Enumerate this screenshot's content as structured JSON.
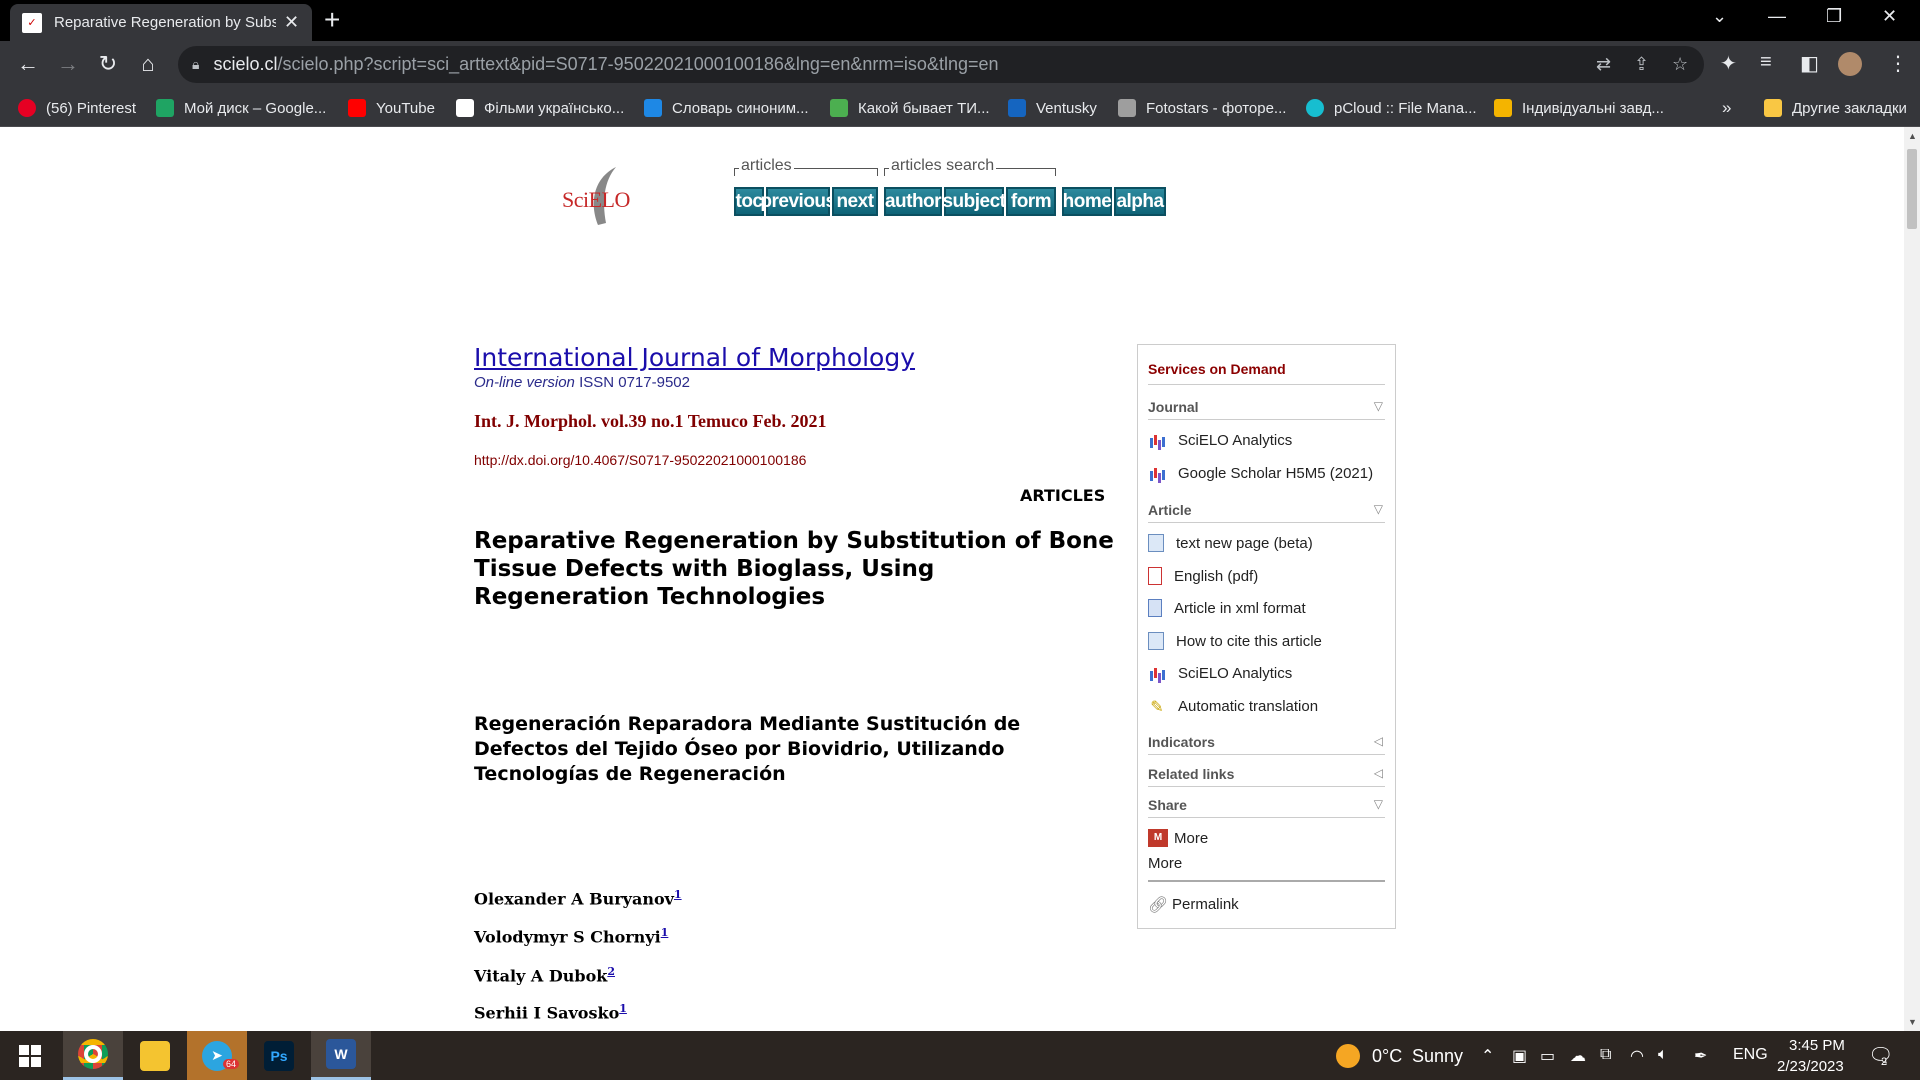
{
  "browser": {
    "tab_title": "Reparative Regeneration by Subs",
    "url_host": "scielo.cl",
    "url_path": "/scielo.php?script=sci_arttext&pid=S0717-95022021000100186&lng=en&nrm=iso&tlng=en"
  },
  "bookmarks": [
    {
      "label": "(56) Pinterest",
      "color": "#e60023"
    },
    {
      "label": "Мой диск – Google...",
      "color": "#1fa463"
    },
    {
      "label": "YouTube",
      "color": "#ff0000"
    },
    {
      "label": "Фільми українсько...",
      "color": "#ffffff"
    },
    {
      "label": "Словарь синоним...",
      "color": "#1e88e5"
    },
    {
      "label": "Какой бывает ТИ...",
      "color": "#4caf50"
    },
    {
      "label": "Ventusky",
      "color": "#1565c0"
    },
    {
      "label": "Fotostars - фоторе...",
      "color": "#9e9e9e"
    },
    {
      "label": "pCloud :: File Mana...",
      "color": "#17bed0"
    },
    {
      "label": "Індивідуальні завд...",
      "color": "#f4b400"
    }
  ],
  "bookmarks_overflow": "»",
  "other_bookmarks": "Другие закладки",
  "scielo": {
    "logo_text": "SciELO",
    "groups": {
      "articles": "articles",
      "articles_search": "articles search"
    },
    "nav_buttons": [
      "toc",
      "previous",
      "next",
      "author",
      "subject",
      "form",
      "home",
      "alpha"
    ]
  },
  "article": {
    "journal_title": "International Journal of Morphology",
    "issn_prefix": "On-line version",
    "issn": "ISSN 0717-9502",
    "issue": "Int. J. Morphol. vol.39 no.1 Temuco Feb. 2021",
    "doi": "http://dx.doi.org/10.4067/S0717-95022021000100186",
    "section": "ARTICLES",
    "title_en": "Reparative Regeneration by Substitution of Bone Tissue Defects with Bioglass, Using Regeneration Technologies",
    "title_es": "Regeneración Reparadora Mediante Sustitución de Defectos del Tejido Óseo por Biovidrio, Utilizando Tecnologías de Regeneración",
    "authors": [
      {
        "name": "Olexander A Buryanov",
        "aff": "1"
      },
      {
        "name": "Volodymyr S Chornyi",
        "aff": "1"
      },
      {
        "name": "Vitaly A Dubok",
        "aff": "2"
      },
      {
        "name": "Serhii I Savosko",
        "aff": "1"
      }
    ]
  },
  "services": {
    "title": "Services on Demand",
    "journal_head": "Journal",
    "journal_items": [
      "SciELO Analytics",
      "Google Scholar H5M5 (2021)"
    ],
    "article_head": "Article",
    "article_items": [
      "text new page (beta)",
      "English (pdf)",
      "Article in xml format",
      "How to cite this article",
      "SciELO Analytics",
      "Automatic translation"
    ],
    "indicators_head": "Indicators",
    "related_head": "Related links",
    "share_head": "Share",
    "share_more1": "More",
    "share_more2": "More",
    "permalink": "Permalink"
  },
  "taskbar": {
    "weather_temp": "0°C",
    "weather_text": "Sunny",
    "lang": "ENG",
    "time": "3:45 PM",
    "date": "2/23/2023",
    "notifications": "2",
    "telegram_badge": "64"
  }
}
